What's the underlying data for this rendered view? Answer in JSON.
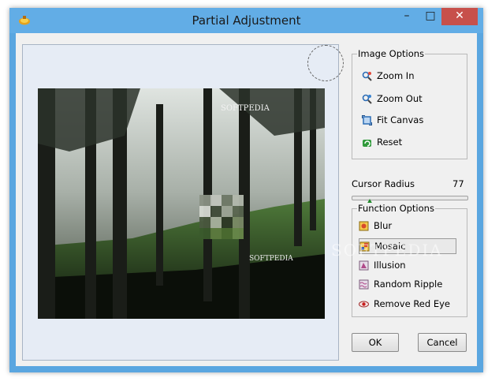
{
  "window": {
    "title": "Partial Adjustment",
    "minimize_glyph": "–",
    "maximize_glyph": "□",
    "close_glyph": "✕"
  },
  "image_options": {
    "legend": "Image Options",
    "items": [
      {
        "label": "Zoom In",
        "icon": "zoom-in-icon"
      },
      {
        "label": "Zoom Out",
        "icon": "zoom-out-icon"
      },
      {
        "label": "Fit Canvas",
        "icon": "fit-canvas-icon"
      },
      {
        "label": "Reset",
        "icon": "reset-icon"
      }
    ]
  },
  "cursor_radius": {
    "label": "Cursor Radius",
    "value": "77"
  },
  "function_options": {
    "legend": "Function Options",
    "items": [
      {
        "label": "Blur",
        "icon": "blur-icon"
      },
      {
        "label": "Mosaic",
        "icon": "mosaic-icon",
        "selected": true
      },
      {
        "label": "Illusion",
        "icon": "illusion-icon"
      },
      {
        "label": "Random Ripple",
        "icon": "random-ripple-icon"
      },
      {
        "label": "Remove Red Eye",
        "icon": "remove-red-eye-icon"
      }
    ]
  },
  "buttons": {
    "ok": "OK",
    "cancel": "Cancel"
  },
  "image": {
    "watermark_top": "SOFTPEDIA",
    "watermark_bottom": "SOFTPEDIA",
    "overlay_watermark": "SOFTPEDIA"
  },
  "colors": {
    "titlebar": "#62ade6",
    "close_button": "#c7504b",
    "client_bg": "#f0f0f0",
    "preview_bg": "#e6ecf5",
    "slider_thumb": "#1f8a2a"
  }
}
